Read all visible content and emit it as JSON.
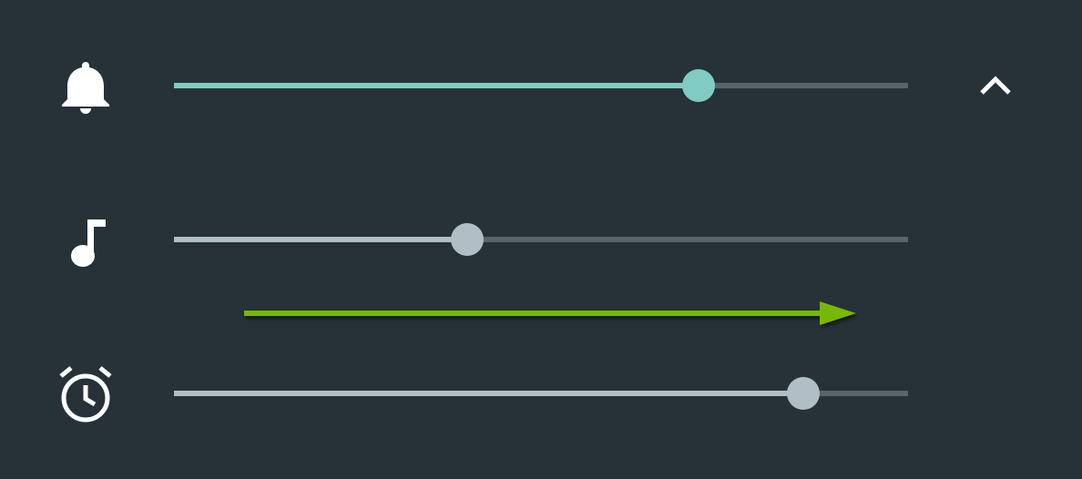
{
  "colors": {
    "background": "#263238",
    "ringer_accent": "#80cbc4",
    "inactive_accent": "#b0bec5",
    "track": "#59636a",
    "icon": "#ffffff",
    "annotation_arrow": "#76b900"
  },
  "rows": [
    {
      "id": "ringer",
      "icon": "bell-icon",
      "value": 0.715,
      "fill_color": "#80cbc4",
      "thumb_color": "#80cbc4"
    },
    {
      "id": "media",
      "icon": "music-note-icon",
      "value": 0.4,
      "fill_color": "#b0bec5",
      "thumb_color": "#b0bec5"
    },
    {
      "id": "alarm",
      "icon": "alarm-clock-icon",
      "value": 0.857,
      "fill_color": "#b0bec5",
      "thumb_color": "#b0bec5"
    }
  ],
  "expand_button": {
    "icon": "chevron-up-icon"
  },
  "annotation": {
    "icon": "right-arrow-icon",
    "direction": "right",
    "color": "#76b900"
  }
}
